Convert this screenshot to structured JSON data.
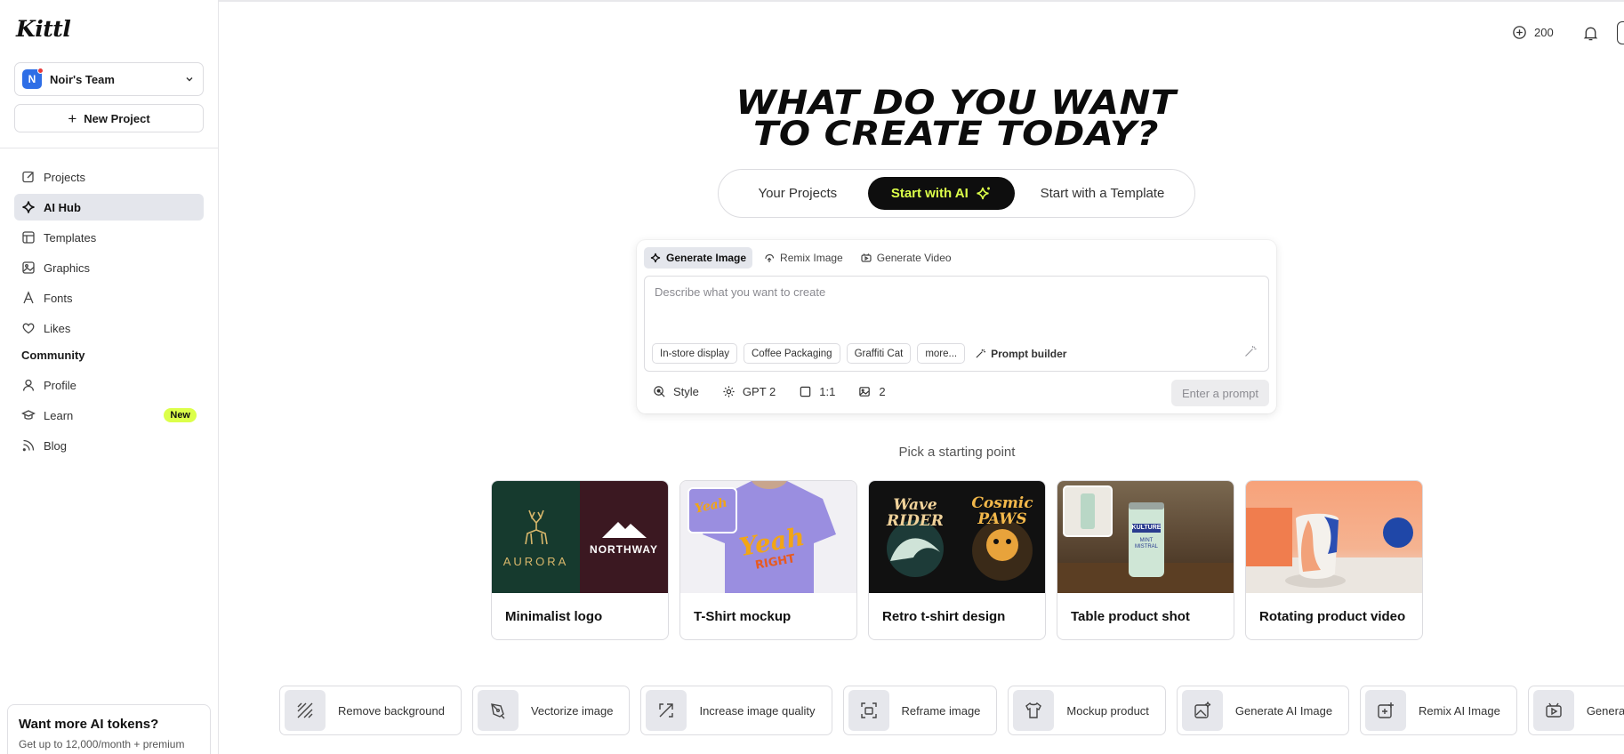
{
  "app": {
    "logo": "Kittl"
  },
  "sidebar": {
    "team": {
      "initial": "N",
      "name": "Noir's Team"
    },
    "new_project": "New Project",
    "items": [
      {
        "label": "Projects",
        "icon": "edit-icon"
      },
      {
        "label": "AI Hub",
        "icon": "sparkle-icon",
        "active": true
      },
      {
        "label": "Templates",
        "icon": "template-icon"
      },
      {
        "label": "Graphics",
        "icon": "image-icon"
      },
      {
        "label": "Fonts",
        "icon": "font-icon"
      },
      {
        "label": "Likes",
        "icon": "heart-icon"
      }
    ],
    "community_heading": "Community",
    "community_items": [
      {
        "label": "Profile",
        "icon": "user-icon"
      },
      {
        "label": "Learn",
        "icon": "graduation-cap-icon",
        "badge": "New"
      },
      {
        "label": "Blog",
        "icon": "rss-icon"
      }
    ],
    "promo": {
      "title": "Want more AI tokens?",
      "subtitle": "Get up to 12,000/month + premium"
    }
  },
  "topbar": {
    "credits": "200"
  },
  "hero": {
    "line1": "WHAT DO YOU WANT",
    "line2": "TO CREATE TODAY?"
  },
  "tabs": {
    "your_projects": "Your Projects",
    "start_ai": "Start with AI",
    "start_template": "Start with a Template"
  },
  "prompt": {
    "modes": [
      "Generate Image",
      "Remix Image",
      "Generate Video"
    ],
    "placeholder": "Describe what you want to create",
    "chips": [
      "In-store display",
      "Coffee Packaging",
      "Graffiti Cat",
      "more..."
    ],
    "prompt_builder": "Prompt builder",
    "options": {
      "style": "Style",
      "model": "GPT 2",
      "ratio": "1:1",
      "count": "2"
    },
    "submit": "Enter a prompt"
  },
  "starting_point": {
    "heading": "Pick a starting point",
    "cards": [
      {
        "label": "Minimalist logo",
        "art1": "AURORA",
        "art2": "NORTHWAY"
      },
      {
        "label": "T-Shirt mockup",
        "art1": "Yeah",
        "art2": "RIGHT"
      },
      {
        "label": "Retro t-shirt design",
        "art1": "Wave RIDER",
        "art2": "Cosmic PAWS"
      },
      {
        "label": "Table product shot",
        "art1": "KULTURE",
        "art2": "MINT MISTRAL"
      },
      {
        "label": "Rotating product video"
      }
    ]
  },
  "tools": [
    {
      "label": "Remove background",
      "icon": "remove-bg-icon"
    },
    {
      "label": "Vectorize image",
      "icon": "pen-tool-icon"
    },
    {
      "label": "Increase image quality",
      "icon": "upscale-icon"
    },
    {
      "label": "Reframe image",
      "icon": "reframe-icon"
    },
    {
      "label": "Mockup product",
      "icon": "shirt-icon"
    },
    {
      "label": "Generate AI Image",
      "icon": "image-sparkle-icon"
    },
    {
      "label": "Remix AI Image",
      "icon": "image-plus-icon"
    },
    {
      "label": "Generate Video",
      "icon": "video-icon"
    }
  ],
  "colors": {
    "accent": "#dcff4a",
    "dark": "#0e0e0e",
    "active_bg": "#e4e6ec",
    "team_avatar": "#2e6ee6"
  }
}
